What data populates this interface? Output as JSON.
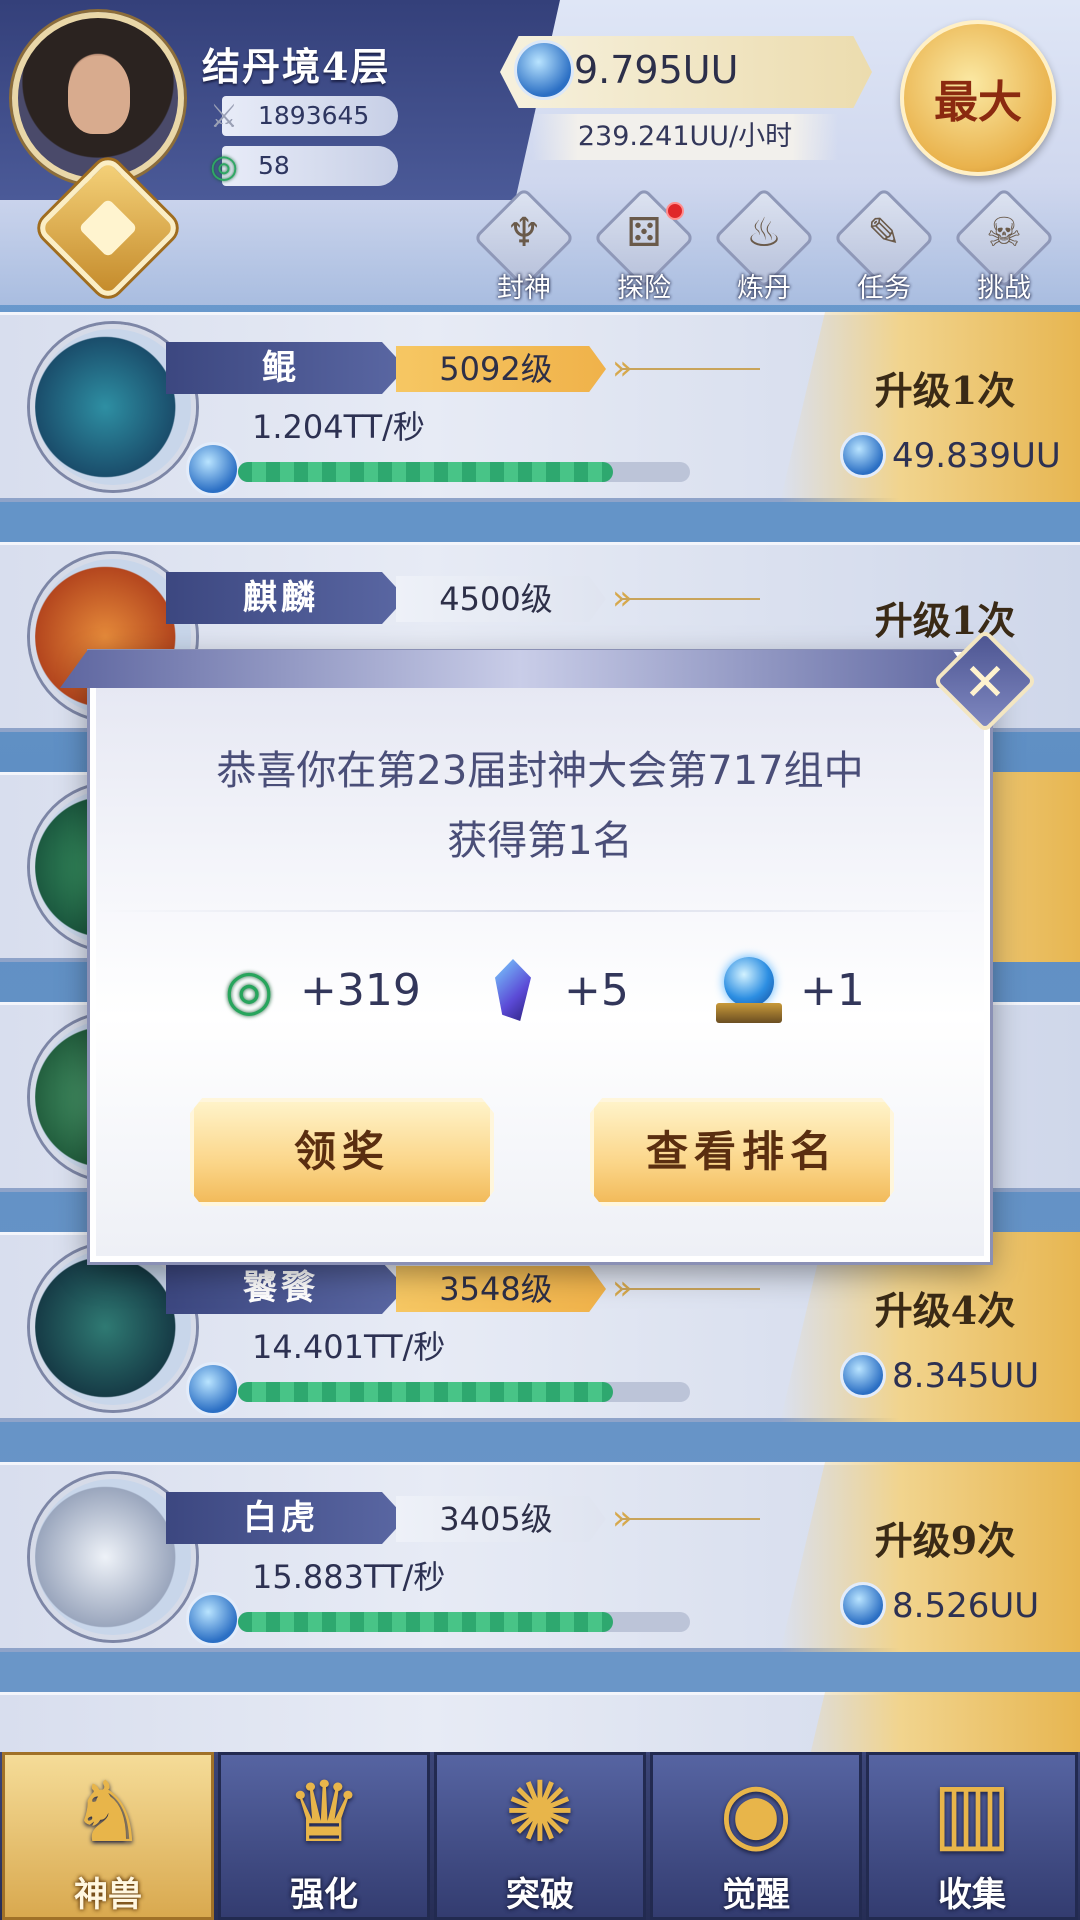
{
  "player": {
    "realm": "结丹境4层",
    "power": "1893645",
    "jade": "58"
  },
  "currency": {
    "amount": "9.795UU",
    "rate": "239.241UU/小时",
    "max_label": "最大"
  },
  "top_menu": [
    {
      "label": "封神",
      "icon": "torch-icon",
      "glyph": "♆"
    },
    {
      "label": "探险",
      "icon": "dice-icon",
      "glyph": "⚄"
    },
    {
      "label": "炼丹",
      "icon": "cauldron-icon",
      "glyph": "♨"
    },
    {
      "label": "任务",
      "icon": "scroll-icon",
      "glyph": "✎"
    },
    {
      "label": "挑战",
      "icon": "skull-icon",
      "glyph": "☠"
    }
  ],
  "beasts": [
    {
      "name": "鲲",
      "level": "5092级",
      "income": "1.204TT/秒",
      "upgrade": "升级1次",
      "cost": "49.839UU",
      "progress": 0.83
    },
    {
      "name": "麒麟",
      "level": "4500级",
      "income": "",
      "upgrade": "升级1次",
      "cost": "",
      "progress": 0
    },
    {
      "name": "饕餮",
      "level": "3548级",
      "income": "14.401TT/秒",
      "upgrade": "升级4次",
      "cost": "8.345UU",
      "progress": 0.83
    },
    {
      "name": "白虎",
      "level": "3405级",
      "income": "15.883TT/秒",
      "upgrade": "升级9次",
      "cost": "8.526UU",
      "progress": 0.83
    }
  ],
  "modal": {
    "line1": "恭喜你在第23届封神大会第717组中",
    "line2": "获得第1名",
    "rewards": [
      {
        "icon": "jade-icon",
        "amount": "+319"
      },
      {
        "icon": "crystal-icon",
        "amount": "+5"
      },
      {
        "icon": "orb-icon",
        "amount": "+1"
      }
    ],
    "claim_label": "领奖",
    "ranking_label": "查看排名"
  },
  "bottom_nav": [
    {
      "label": "神兽",
      "icon": "qilin-icon",
      "glyph": "♞"
    },
    {
      "label": "强化",
      "icon": "crown-icon",
      "glyph": "♛"
    },
    {
      "label": "突破",
      "icon": "flame-orb-icon",
      "glyph": "✺"
    },
    {
      "label": "觉醒",
      "icon": "eye-icon",
      "glyph": "◉"
    },
    {
      "label": "收集",
      "icon": "scroll-icon",
      "glyph": "▥"
    }
  ]
}
